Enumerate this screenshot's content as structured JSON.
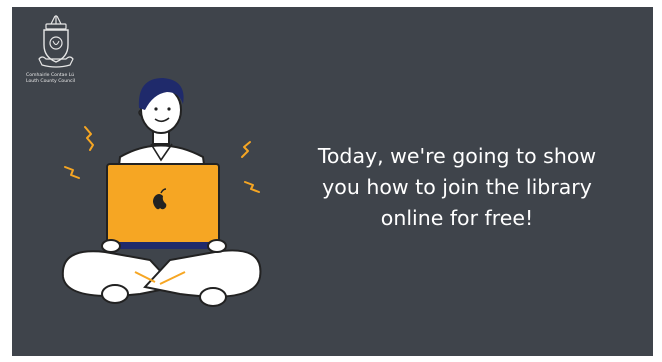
{
  "logo": {
    "name": "crest-icon",
    "line1": "Comhairle Contae Lú",
    "line2": "Louth County Council"
  },
  "message": {
    "line1": "Today, we're going to show",
    "line2": "you how to join the library",
    "line3": "online for free!"
  },
  "illustration": {
    "name": "person-with-laptop-illustration",
    "laptop_color": "#f6a623",
    "accent_color": "#f6a623"
  },
  "colors": {
    "background": "#3f444b",
    "text": "#ffffff"
  }
}
